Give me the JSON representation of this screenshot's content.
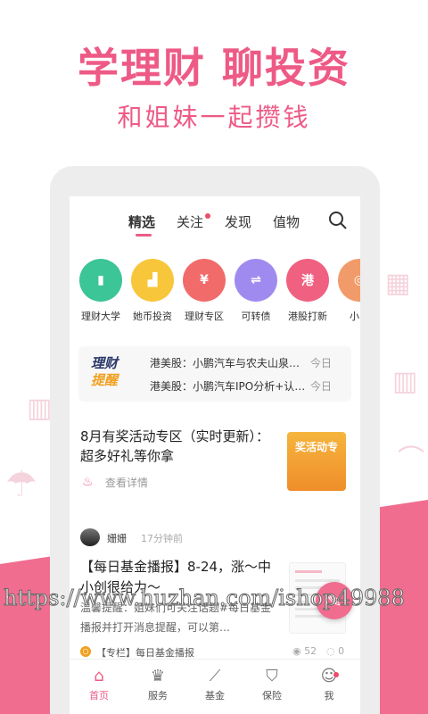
{
  "hero": {
    "headline": "学理财 聊投资",
    "subline": "和姐妹一起攒钱"
  },
  "top_tabs": [
    {
      "label": "精选",
      "active": true
    },
    {
      "label": "关注",
      "has_dot": true
    },
    {
      "label": "发现"
    },
    {
      "label": "值物"
    }
  ],
  "categories": [
    {
      "label": "理财大学",
      "icon": "book-icon",
      "color": "#3cc596"
    },
    {
      "label": "她币投资",
      "icon": "chart-icon",
      "color": "#f7c63a"
    },
    {
      "label": "理财专区",
      "icon": "yen-icon",
      "color": "#f16b6b"
    },
    {
      "label": "可转债",
      "icon": "bond-icon",
      "color": "#9f8bf0"
    },
    {
      "label": "港股打新",
      "icon": "hk-icon",
      "color": "#f06080",
      "glyph": "港"
    },
    {
      "label": "小目",
      "icon": "target-icon",
      "color": "#f29b6a"
    }
  ],
  "notice": {
    "logo_line1": "理财",
    "logo_line2": "提醒",
    "items": [
      {
        "text": "港美股：小鹏汽车与农夫山泉…",
        "date": "今日"
      },
      {
        "text": "港美股：小鹏汽车IPO分析+认…",
        "date": "今日"
      }
    ]
  },
  "article1": {
    "title": "8月有奖活动专区（实时更新）：超多好礼等你拿",
    "link": "查看详情",
    "image_text": "奖活动专"
  },
  "article2": {
    "author": "姗姗",
    "time": "17分钟前",
    "title": "【每日基金播报】8-24，涨～中小创很给力～",
    "desc": "温馨提醒：姐妹们可关注话题#每日基金播报并打开消息提醒，可以第…",
    "column": "【专栏】每日基金播报",
    "views": "52",
    "comments": "0"
  },
  "bottom_nav": [
    {
      "label": "首页",
      "icon": "home-icon",
      "active": true
    },
    {
      "label": "服务",
      "icon": "crown-icon"
    },
    {
      "label": "基金",
      "icon": "chart-line-icon"
    },
    {
      "label": "保险",
      "icon": "shield-icon"
    },
    {
      "label": "我",
      "icon": "user-icon",
      "has_dot": true
    }
  ],
  "watermark": "https://www.huzhan.com/ishop49988",
  "colors": {
    "accent": "#ee5a86",
    "pink_bg": "#f06d8f"
  }
}
